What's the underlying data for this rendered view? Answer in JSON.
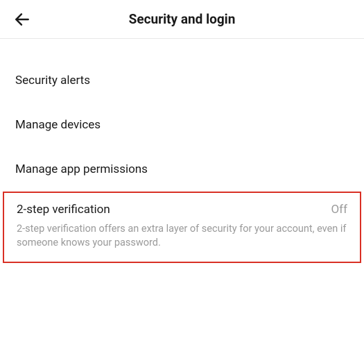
{
  "header": {
    "title": "Security and login"
  },
  "items": {
    "security_alerts": "Security alerts",
    "manage_devices": "Manage devices",
    "manage_permissions": "Manage app permissions"
  },
  "two_step": {
    "label": "2-step verification",
    "status": "Off",
    "description": "2-step verification offers an extra layer of security for your account, even if someone knows your password."
  }
}
